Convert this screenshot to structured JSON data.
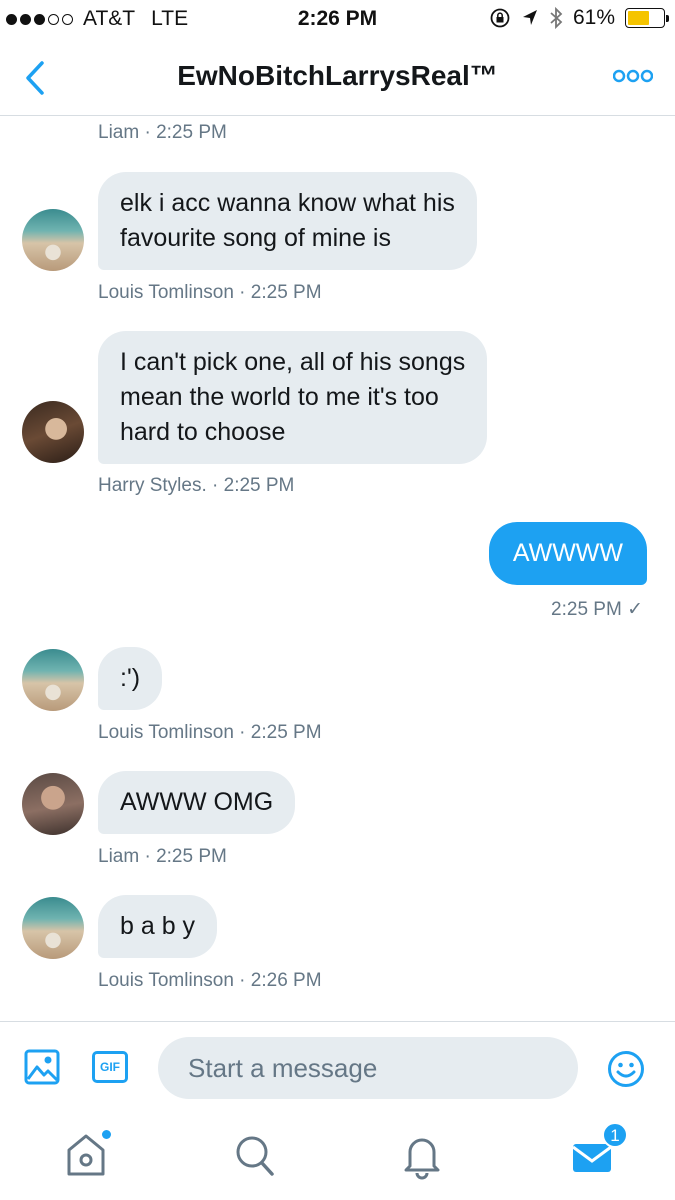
{
  "status_bar": {
    "carrier": "AT&T",
    "network": "LTE",
    "time": "2:26 PM",
    "battery": "61%",
    "battery_level": 0.61
  },
  "header": {
    "title": "EwNoBitchLarrysReal™"
  },
  "messages": [
    {
      "type": "meta",
      "text": "Liam · 2:25 PM"
    },
    {
      "type": "received",
      "sender": "Louis Tomlinson",
      "lines": [
        "elk i acc wanna know what his",
        "favourite song of mine is"
      ],
      "meta": "Louis Tomlinson · 2:25 PM"
    },
    {
      "type": "received",
      "sender": "Harry Styles.",
      "lines": [
        "I can't pick one, all of his songs",
        "mean the world to me it's too",
        "hard to choose"
      ],
      "meta": "Harry Styles. · 2:25 PM"
    },
    {
      "type": "sent",
      "text": "AWWWW",
      "meta": "2:25 PM ✓"
    },
    {
      "type": "received",
      "sender": "Louis Tomlinson",
      "text": ":')",
      "meta": "Louis Tomlinson · 2:25 PM"
    },
    {
      "type": "received",
      "sender": "Liam",
      "text": "AWWW OMG",
      "meta": "Liam · 2:25 PM"
    },
    {
      "type": "received",
      "sender": "Louis Tomlinson",
      "text": "b a b y",
      "meta": "Louis Tomlinson · 2:26 PM"
    }
  ],
  "composer": {
    "gif_label": "GIF",
    "placeholder": "Start a message"
  },
  "tab_bar": {
    "messages_badge": "1"
  },
  "colors": {
    "accent": "#1da1f2",
    "bubble_received": "#e6ecf0",
    "meta_text": "#657786"
  }
}
